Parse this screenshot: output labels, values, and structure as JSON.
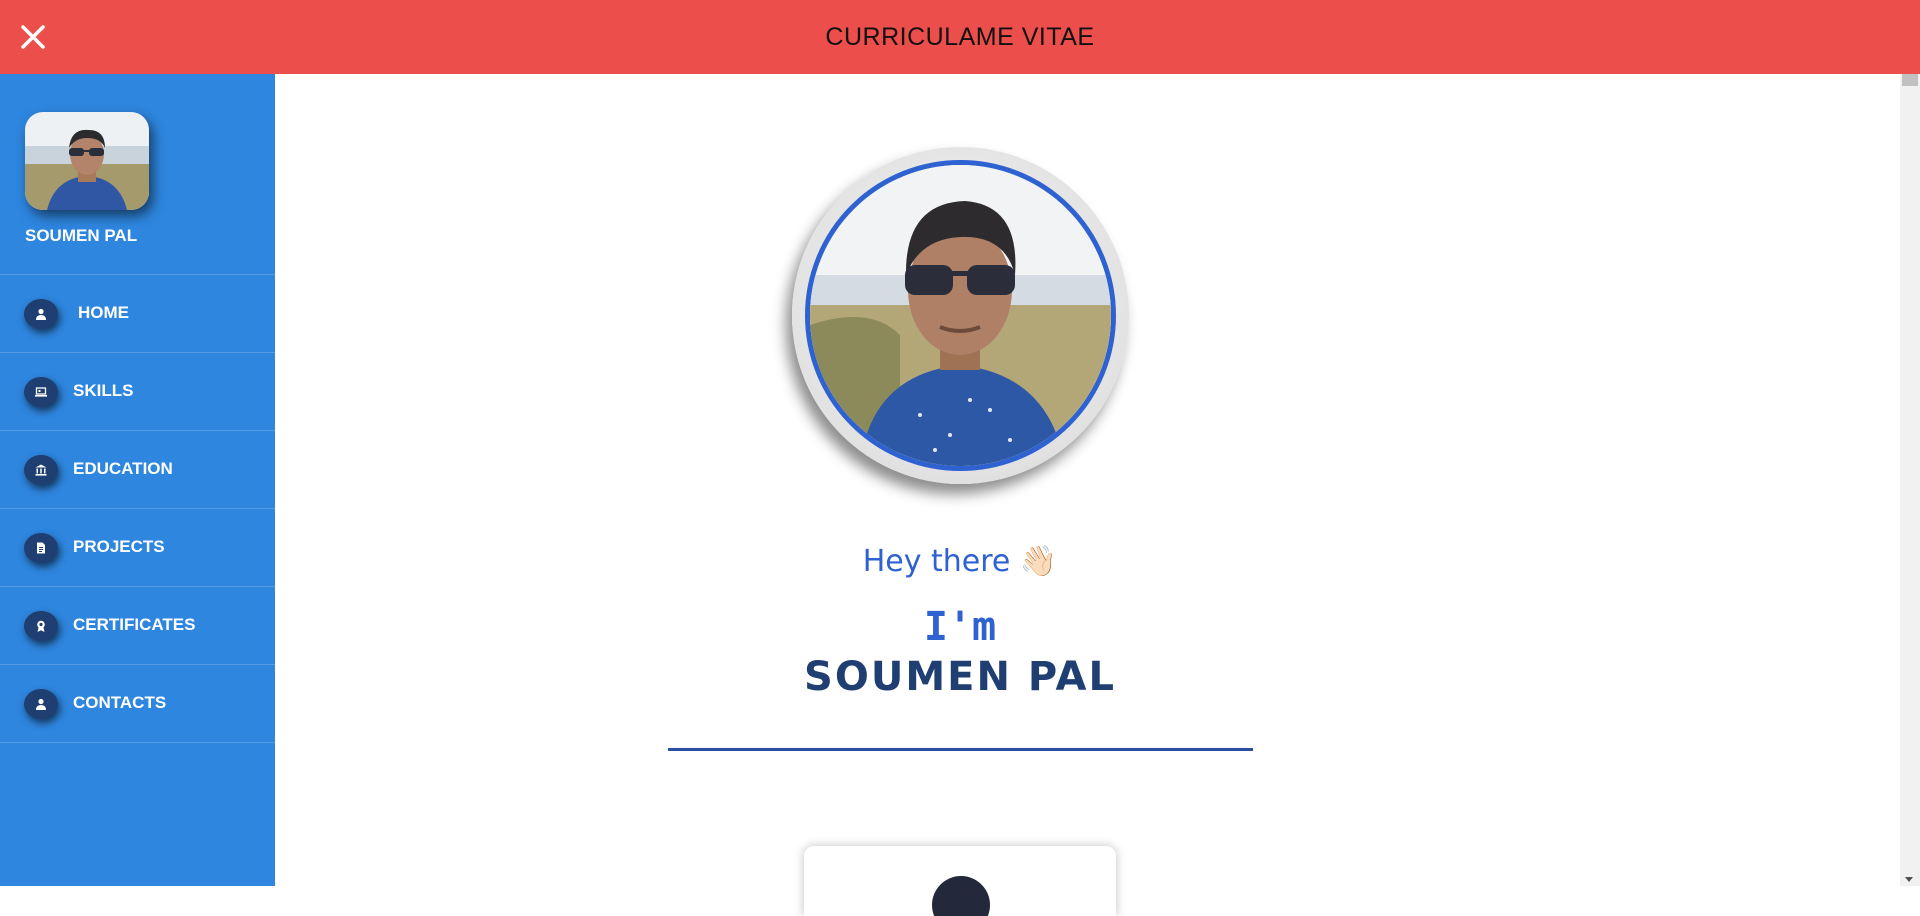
{
  "header": {
    "title": "CURRICULAME VITAE",
    "close_icon": "close-icon",
    "background_color": "#ec4e4b"
  },
  "sidebar": {
    "background_color": "#2e86df",
    "profile_name": "SOUMEN PAL",
    "items": [
      {
        "label": "HOME",
        "icon": "user-icon"
      },
      {
        "label": "SKILLS",
        "icon": "laptop-icon"
      },
      {
        "label": "EDUCATION",
        "icon": "institution-icon"
      },
      {
        "label": "PROJECTS",
        "icon": "document-icon"
      },
      {
        "label": "CERTIFICATES",
        "icon": "award-icon"
      },
      {
        "label": "CONTACTS",
        "icon": "user-icon"
      }
    ]
  },
  "hero": {
    "greeting": "Hey there 👋🏻",
    "intro": "I'm",
    "name": "SOUMEN PAL",
    "accent_color": "#2f62d1",
    "name_color": "#1f3e72"
  }
}
